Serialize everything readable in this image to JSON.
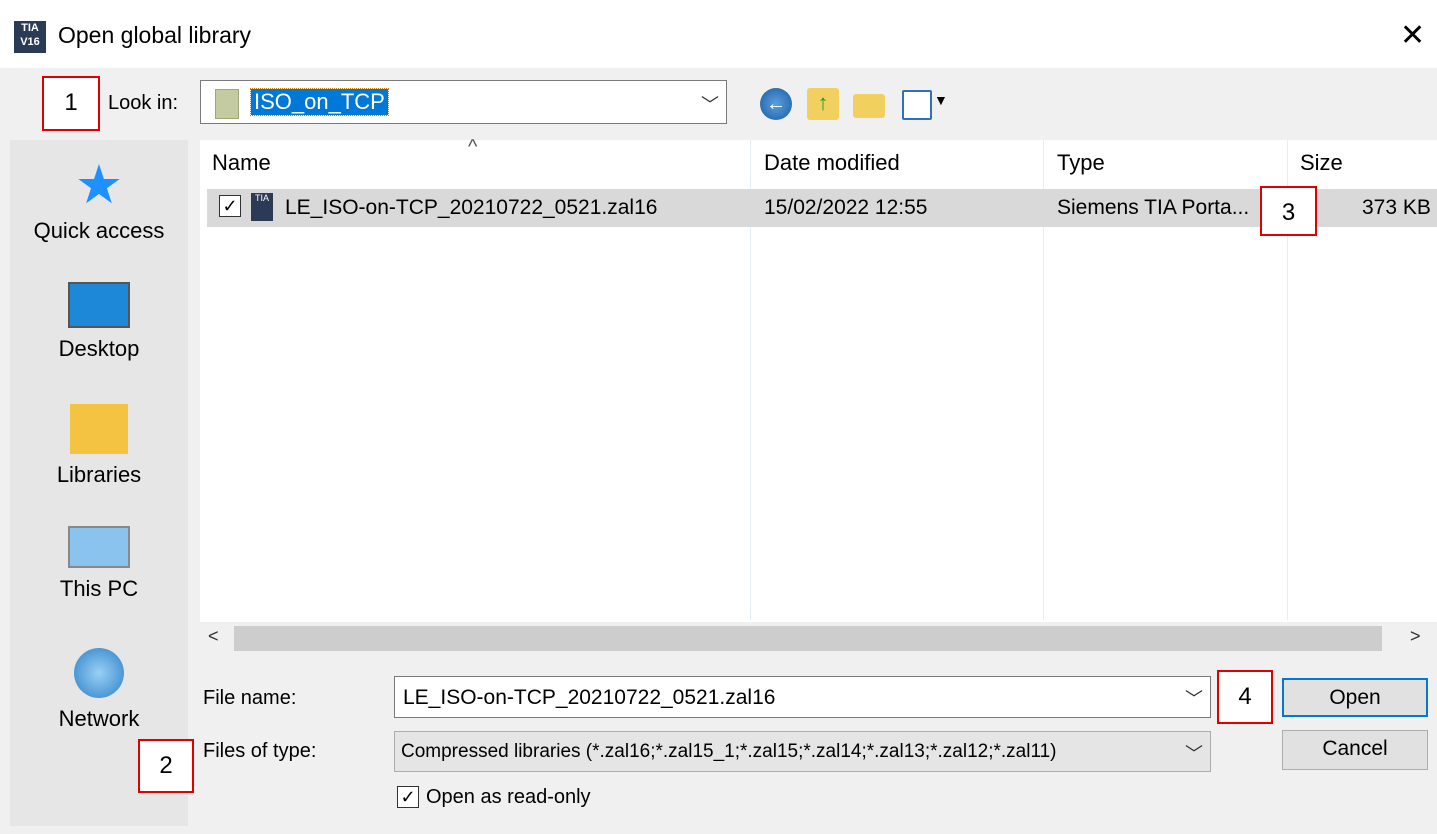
{
  "window": {
    "title": "Open global library",
    "app_icon": "TIA V16"
  },
  "toolbar": {
    "look_in_label": "Look in:",
    "look_in_value": "ISO_on_TCP",
    "icons": [
      "back-icon",
      "up-folder-icon",
      "new-folder-icon",
      "view-menu-icon"
    ]
  },
  "places": [
    {
      "label": "Quick access",
      "icon": "star-icon"
    },
    {
      "label": "Desktop",
      "icon": "desktop-icon"
    },
    {
      "label": "Libraries",
      "icon": "libraries-icon"
    },
    {
      "label": "This PC",
      "icon": "computer-icon"
    },
    {
      "label": "Network",
      "icon": "network-icon"
    }
  ],
  "columns": [
    "Name",
    "Date modified",
    "Type",
    "Size"
  ],
  "files": [
    {
      "name": "LE_ISO-on-TCP_20210722_0521.zal16",
      "date": "15/02/2022 12:55",
      "type": "Siemens TIA Porta...",
      "size": "373 KB",
      "checked": true
    }
  ],
  "form": {
    "file_name_label": "File name:",
    "file_name_value": "LE_ISO-on-TCP_20210722_0521.zal16",
    "file_type_label": "Files of type:",
    "file_type_value": "Compressed libraries (*.zal16;*.zal15_1;*.zal15;*.zal14;*.zal13;*.zal12;*.zal11)",
    "readonly_label": "Open as read-only",
    "readonly_checked": true
  },
  "buttons": {
    "open": "Open",
    "cancel": "Cancel"
  },
  "annotations": [
    "1",
    "2",
    "3",
    "4"
  ],
  "colors": {
    "selection": "#0078d7",
    "annotation": "#e00000",
    "row_highlight": "#d9d9d9"
  }
}
